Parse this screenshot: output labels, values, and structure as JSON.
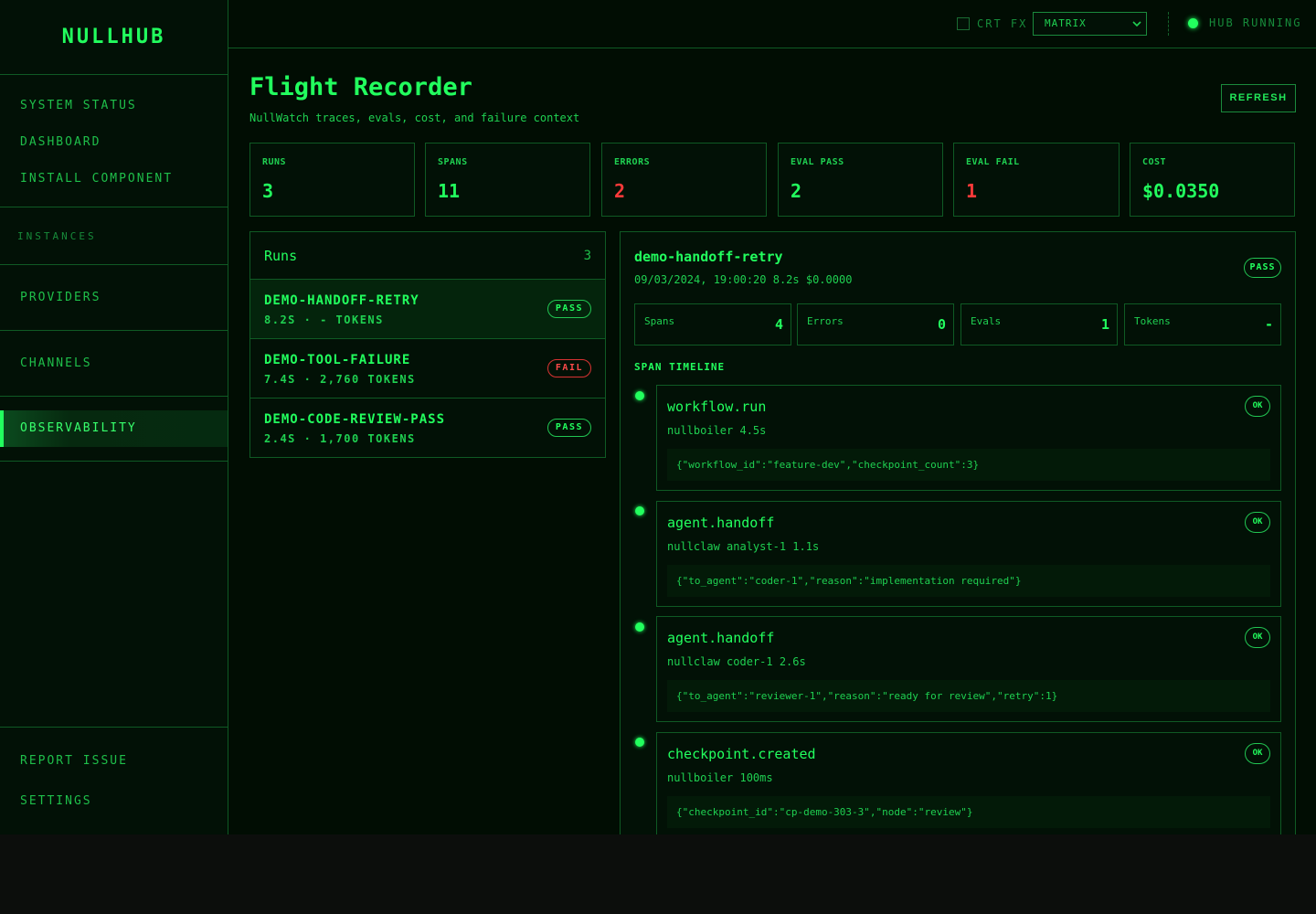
{
  "app": {
    "logo": "NULLHUB"
  },
  "sidebar": {
    "top_items": [
      "SYSTEM STATUS",
      "DASHBOARD",
      "INSTALL COMPONENT"
    ],
    "section_label": "INSTANCES",
    "providers": "PROVIDERS",
    "channels": "CHANNELS",
    "active_item": "OBSERVABILITY",
    "bottom_items": [
      "REPORT ISSUE",
      "SETTINGS"
    ]
  },
  "topbar": {
    "crt_label": "CRT FX",
    "crt_checked": false,
    "theme_value": "MATRIX",
    "hub_status": "HUB RUNNING"
  },
  "header": {
    "title": "Flight Recorder",
    "subtitle": "NullWatch traces, evals, cost, and failure context",
    "refresh_label": "REFRESH"
  },
  "stats": [
    {
      "label": "RUNS",
      "value": "3",
      "status": "ok"
    },
    {
      "label": "SPANS",
      "value": "11",
      "status": "ok"
    },
    {
      "label": "ERRORS",
      "value": "2",
      "status": "error"
    },
    {
      "label": "EVAL PASS",
      "value": "2",
      "status": "ok"
    },
    {
      "label": "EVAL FAIL",
      "value": "1",
      "status": "error"
    },
    {
      "label": "COST",
      "value": "$0.0350",
      "status": "ok"
    }
  ],
  "runs": {
    "title": "Runs",
    "count": "3",
    "items": [
      {
        "name": "demo-handoff-retry",
        "meta": "8.2s · - tokens",
        "badge": "PASS"
      },
      {
        "name": "demo-tool-failure",
        "meta": "7.4s · 2,760 tokens",
        "badge": "FAIL"
      },
      {
        "name": "demo-code-review-pass",
        "meta": "2.4s · 1,700 tokens",
        "badge": "PASS"
      }
    ]
  },
  "detail": {
    "title": "demo-handoff-retry",
    "meta": "09/03/2024, 19:00:20 8.2s $0.0000",
    "badge": "PASS",
    "summary": [
      {
        "label": "Spans",
        "value": "4"
      },
      {
        "label": "Errors",
        "value": "0"
      },
      {
        "label": "Evals",
        "value": "1"
      },
      {
        "label": "Tokens",
        "value": "-"
      }
    ],
    "timeline_label": "SPAN TIMELINE",
    "spans": [
      {
        "name": "workflow.run",
        "meta": "nullboiler 4.5s",
        "status": "OK",
        "json": "{\"workflow_id\":\"feature-dev\",\"checkpoint_count\":3}"
      },
      {
        "name": "agent.handoff",
        "meta": "nullclaw analyst-1 1.1s",
        "status": "OK",
        "json": "{\"to_agent\":\"coder-1\",\"reason\":\"implementation required\"}"
      },
      {
        "name": "agent.handoff",
        "meta": "nullclaw coder-1 2.6s",
        "status": "OK",
        "json": "{\"to_agent\":\"reviewer-1\",\"reason\":\"ready for review\",\"retry\":1}"
      },
      {
        "name": "checkpoint.created",
        "meta": "nullboiler 100ms",
        "status": "OK",
        "json": "{\"checkpoint_id\":\"cp-demo-303-3\",\"node\":\"review\"}"
      }
    ]
  },
  "colors": {
    "accent": "#22ff5e",
    "error": "#ff3a3a",
    "background": "#010d03",
    "border": "#0f5a24"
  }
}
